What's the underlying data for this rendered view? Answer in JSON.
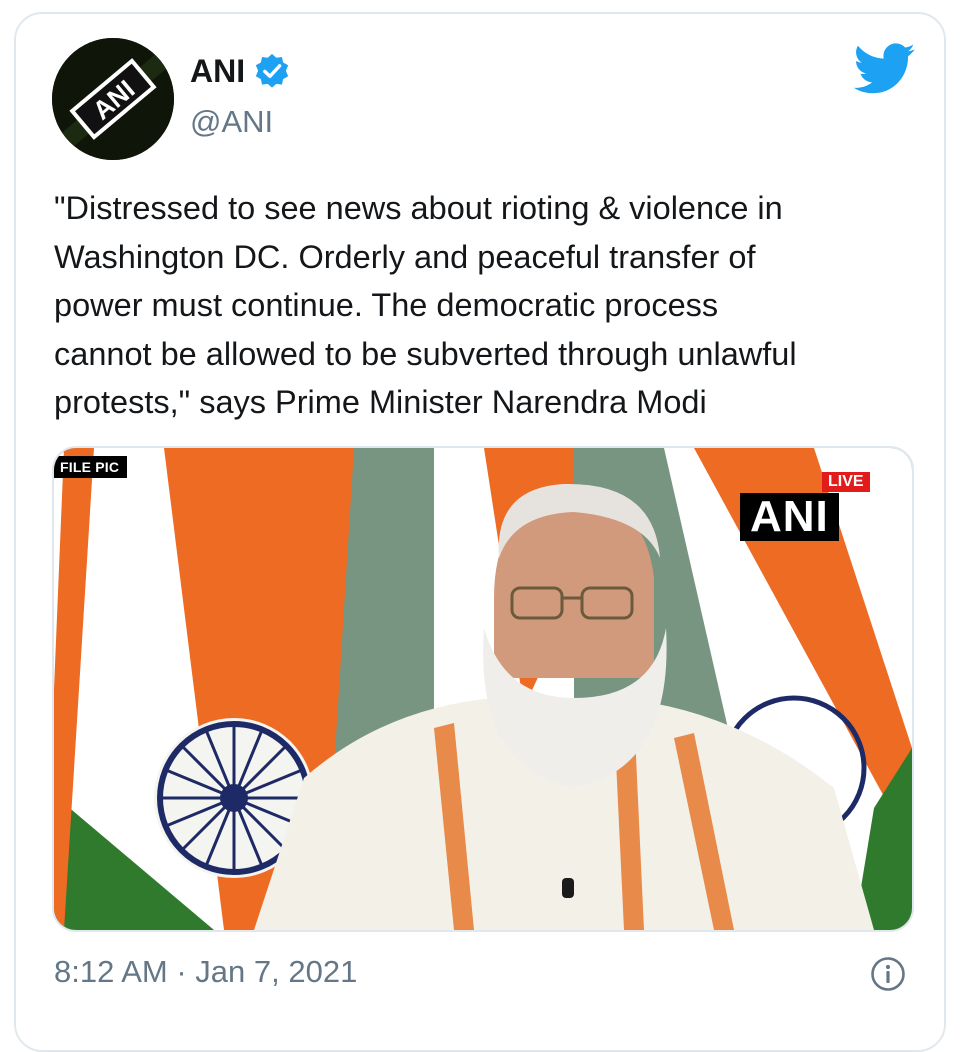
{
  "tweet": {
    "display_name": "ANI",
    "handle": "@ANI",
    "avatar_text": "ANI",
    "text": "\"Distressed to see news about rioting & violence in\nWashington DC. Orderly and peaceful transfer of\npower must continue. The democratic process\ncannot be allowed to be subverted through unlawful\nprotests,\" says Prime Minister Narendra Modi",
    "media": {
      "file_pic_label": "FILE PIC",
      "live_label": "LIVE",
      "logo_text": "ANI"
    },
    "timestamp": "8:12 AM · Jan 7, 2021"
  },
  "colors": {
    "verified_blue": "#1da1f2",
    "twitter_blue": "#1da1f2",
    "text": "#14171a",
    "muted": "#657786",
    "saffron": "#ee6b24",
    "flag_green": "#2f7a2c",
    "chakra_navy": "#1e2a66"
  },
  "icons": {
    "verified": "verified-badge-icon",
    "bird": "twitter-bird-icon",
    "info": "info-icon"
  }
}
